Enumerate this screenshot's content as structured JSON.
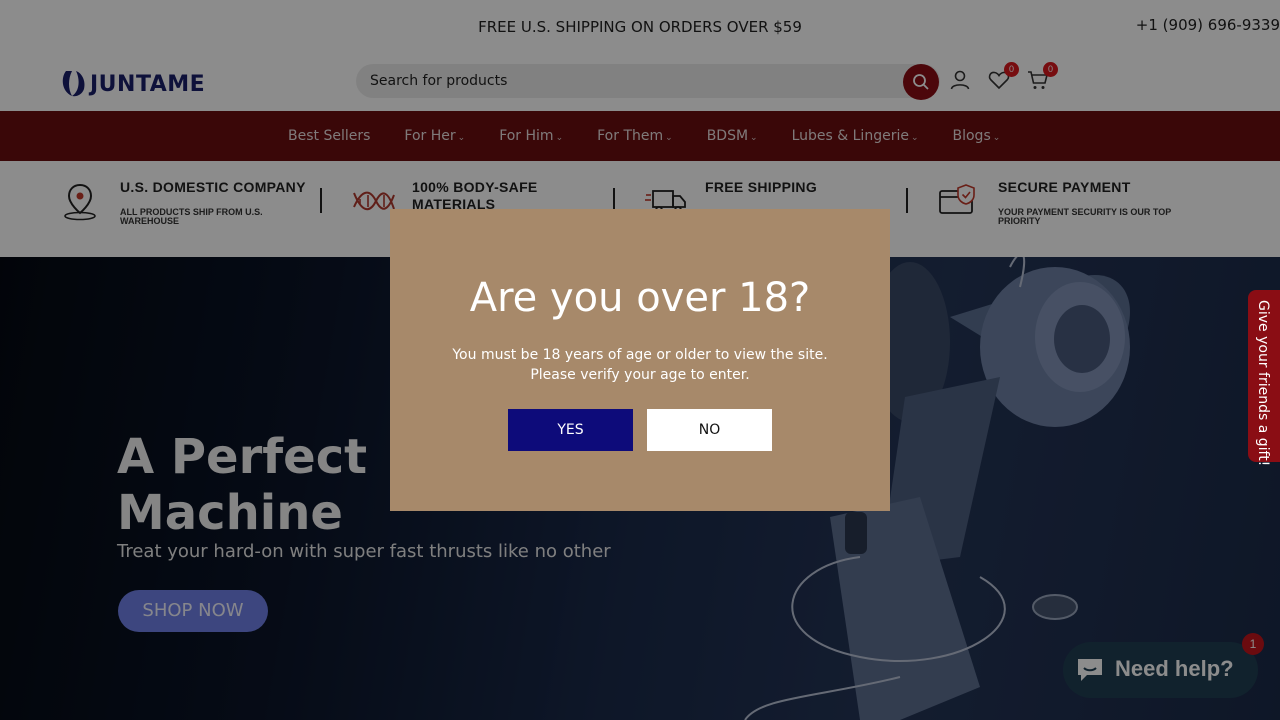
{
  "announcement": {
    "text": "FREE U.S. SHIPPING ON ORDERS OVER $59",
    "phone": "+1 (909) 696-9339"
  },
  "header": {
    "logo_text": "JUNTAME",
    "search": {
      "placeholder": "Search for products",
      "icon": "search-icon"
    },
    "account_icon": "user-icon",
    "wishlist": {
      "icon": "heart-icon",
      "count": "0"
    },
    "cart": {
      "icon": "cart-icon",
      "count": "0"
    }
  },
  "nav": {
    "items": [
      {
        "label": "Best Sellers",
        "has_dropdown": false
      },
      {
        "label": "For Her",
        "has_dropdown": true
      },
      {
        "label": "For Him",
        "has_dropdown": true
      },
      {
        "label": "For Them",
        "has_dropdown": true
      },
      {
        "label": "BDSM",
        "has_dropdown": true
      },
      {
        "label": "Lubes & Lingerie",
        "has_dropdown": true
      },
      {
        "label": "Blogs",
        "has_dropdown": true
      }
    ]
  },
  "features": [
    {
      "title": "U.S. DOMESTIC COMPANY",
      "subtitle": "ALL PRODUCTS SHIP FROM U.S. WAREHOUSE",
      "icon": "location-pin-icon"
    },
    {
      "title": "100% BODY-SAFE MATERIALS",
      "subtitle": "",
      "icon": "dna-icon"
    },
    {
      "title": "FREE SHIPPING",
      "subtitle": "",
      "icon": "truck-icon"
    },
    {
      "title": "SECURE PAYMENT",
      "subtitle": "YOUR PAYMENT SECURITY IS OUR TOP PRIORITY",
      "icon": "secure-card-icon"
    }
  ],
  "hero": {
    "headline": "A Perfect Machine",
    "headline_line1": "A Perfect",
    "headline_line2": "Machine",
    "subtitle": "Treat your hard-on with super fast thrusts like no other",
    "button": "SHOP NOW"
  },
  "gift_tab": {
    "label": "Give your friends a gift!"
  },
  "chat": {
    "label": "Need help?",
    "badge": "1",
    "icon": "chat-bubble-icon"
  },
  "age_modal": {
    "title": "Are you over 18?",
    "line1": "You must be 18 years of age or older to view the site.",
    "line2": "Please verify your age to enter.",
    "yes": "YES",
    "no": "NO"
  },
  "colors": {
    "nav_bg": "#6b0d10",
    "accent_red": "#8a0d14",
    "modal_bg": "#a7896a",
    "yes_button": "#0d0b7a",
    "logo": "#1a1f6b"
  }
}
